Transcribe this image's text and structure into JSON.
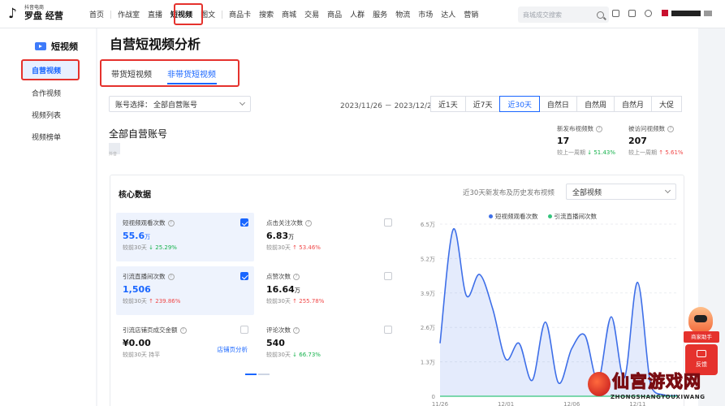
{
  "brand": {
    "sub": "抖音电商",
    "main": "罗盘 经营"
  },
  "nav": {
    "items": [
      "首页",
      "作战室",
      "直播",
      "短视频",
      "图文",
      "商品卡",
      "搜索",
      "商城",
      "交易",
      "商品",
      "人群",
      "服务",
      "物流",
      "市场",
      "达人",
      "营销"
    ],
    "active": "短视频",
    "badge": "双11"
  },
  "search": {
    "placeholder": "商城成交搜索"
  },
  "sidebar": {
    "title": "短视频",
    "items": [
      {
        "label": "自营视频",
        "active": true
      },
      {
        "label": "合作视频",
        "active": false
      },
      {
        "label": "视频列表",
        "active": false
      },
      {
        "label": "视频榜单",
        "active": false
      }
    ]
  },
  "page": {
    "title": "自营短视频分析"
  },
  "tabs": [
    {
      "label": "带货短视频",
      "active": false
    },
    {
      "label": "非带货短视频",
      "active": true
    }
  ],
  "filters": {
    "account_label": "账号选择：",
    "account_value": "全部自营账号",
    "date_range": "2023/11/26 － 2023/12/25",
    "ranges": [
      "近1天",
      "近7天",
      "近30天",
      "自然日",
      "自然周",
      "自然月",
      "大促"
    ],
    "active_range": "近30天"
  },
  "account": {
    "title": "全部自营账号",
    "avatar_caption": "抖音"
  },
  "summary": [
    {
      "label": "新发布视频数",
      "value": "17",
      "compare_label": "较上一周期",
      "change": "51.43%",
      "direction": "down",
      "color": "#16b24c"
    },
    {
      "label": "被访问视频数",
      "value": "207",
      "compare_label": "较上一周期",
      "change": "5.61%",
      "direction": "up",
      "color": "#f04848"
    }
  ],
  "core": {
    "title": "核心数据",
    "hint": "近30天新发布及历史发布视频",
    "video_filter": "全部视频",
    "metrics": [
      {
        "label": "短视频观看次数",
        "value": "55.6",
        "unit": "万",
        "compare_label": "较前30天",
        "change": "25.29%",
        "direction": "down",
        "checked": true,
        "selected": true
      },
      {
        "label": "点击关注次数",
        "value": "6.83",
        "unit": "万",
        "compare_label": "较前30天",
        "change": "53.46%",
        "direction": "up",
        "checked": false,
        "selected": false
      },
      {
        "label": "引流直播间次数",
        "value": "1,506",
        "unit": "",
        "compare_label": "较前30天",
        "change": "239.86%",
        "direction": "up",
        "checked": true,
        "selected": true
      },
      {
        "label": "点赞次数",
        "value": "16.64",
        "unit": "万",
        "compare_label": "较前30天",
        "change": "255.78%",
        "direction": "up",
        "checked": false,
        "selected": false
      },
      {
        "label": "引流店铺页成交金额",
        "value": "¥0.00",
        "unit": "",
        "compare_label": "较前30天",
        "change": "持平",
        "direction": "flat",
        "checked": false,
        "selected": false,
        "link": "店铺页分析"
      },
      {
        "label": "评论次数",
        "value": "540",
        "unit": "",
        "compare_label": "较前30天",
        "change": "66.73%",
        "direction": "down",
        "checked": false,
        "selected": false
      }
    ]
  },
  "chart_data": {
    "type": "area",
    "x_ticks": [
      "11/26",
      "12/01",
      "12/06",
      "12/11"
    ],
    "y_ticks": [
      "0",
      "1.3万",
      "2.6万",
      "3.9万",
      "5.2万",
      "6.5万"
    ],
    "ylim": [
      0,
      65000
    ],
    "x": [
      "11/26",
      "11/27",
      "11/28",
      "11/29",
      "11/30",
      "12/01",
      "12/02",
      "12/03",
      "12/04",
      "12/05",
      "12/06",
      "12/07",
      "12/08",
      "12/09",
      "12/10",
      "12/11",
      "12/12",
      "12/13",
      "12/14"
    ],
    "series": [
      {
        "name": "短视频观看次数",
        "color": "#3e6fe8",
        "values": [
          20000,
          63000,
          38000,
          46000,
          33000,
          14000,
          20000,
          6000,
          28000,
          5000,
          18000,
          23000,
          6000,
          30000,
          7000,
          43000,
          4000,
          500,
          200
        ]
      },
      {
        "name": "引流直播间次数",
        "color": "#34c47c",
        "values": [
          0,
          0,
          0,
          0,
          0,
          0,
          0,
          0,
          0,
          0,
          0,
          0,
          0,
          0,
          0,
          50,
          0,
          0,
          0
        ]
      }
    ]
  },
  "helper": {
    "label": "商家助手",
    "feedback": "反馈"
  },
  "watermark": {
    "main": "仙宫游戏网",
    "sub": "ZHONGSHANGYOUXIWANG"
  }
}
